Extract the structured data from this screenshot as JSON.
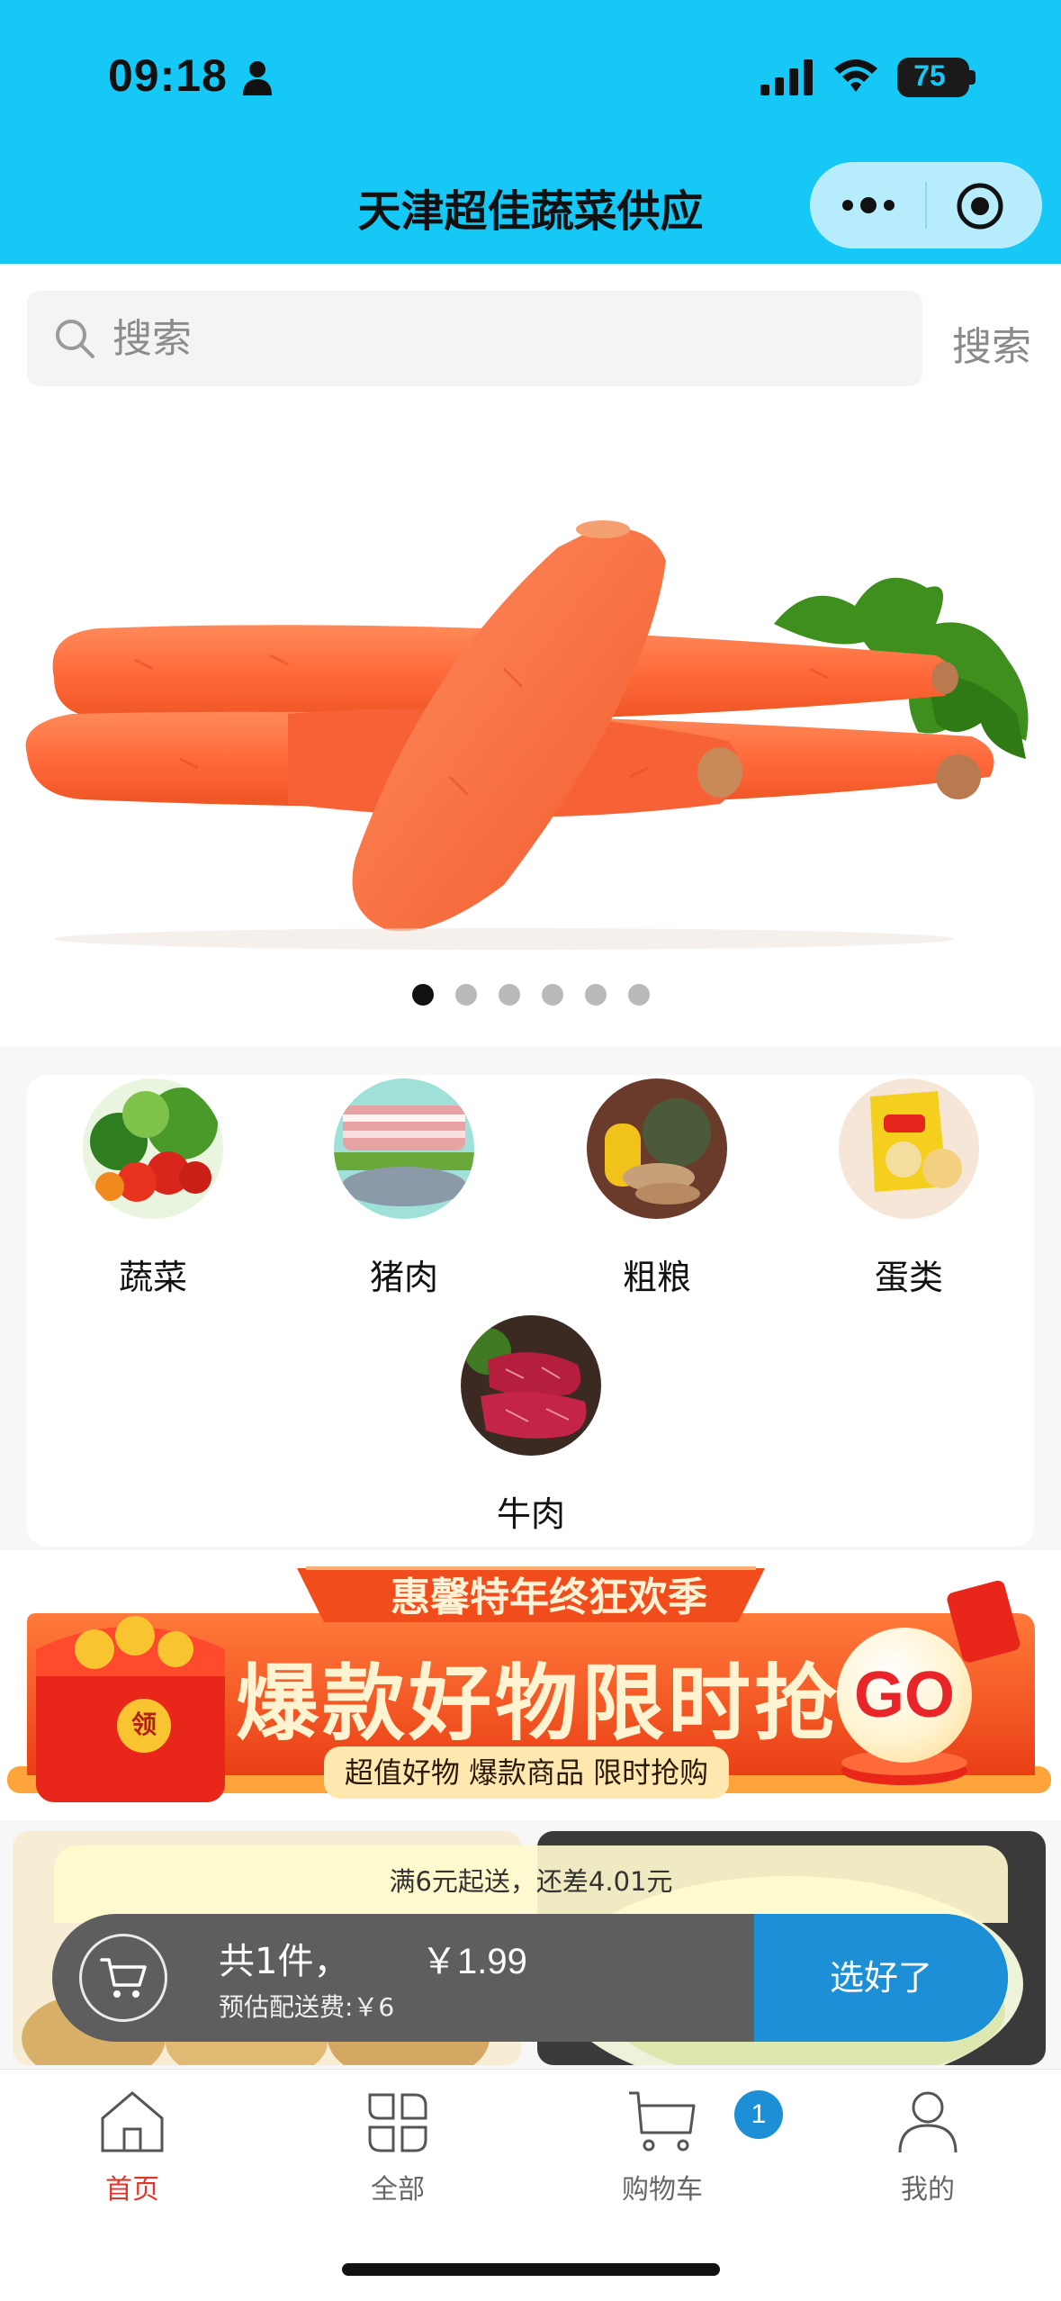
{
  "status_bar": {
    "time": "09:18",
    "battery": "75"
  },
  "nav": {
    "title": "天津超佳蔬菜供应"
  },
  "search": {
    "placeholder": "搜索",
    "button_label": "搜索"
  },
  "banner": {
    "slide_count": 6,
    "active_index": 0
  },
  "categories": [
    {
      "label": "蔬菜"
    },
    {
      "label": "猪肉"
    },
    {
      "label": "粗粮"
    },
    {
      "label": "蛋类"
    },
    {
      "label": "牛肉"
    }
  ],
  "promo": {
    "title": "惠馨特年终狂欢季",
    "headline": "爆款好物限时抢",
    "subline": "超值好物 爆款商品 限时抢购",
    "go_label": "GO",
    "coupon_label": "领"
  },
  "cart": {
    "minimum_tip": "满6元起送，还差4.01元",
    "count_text": "共1件，",
    "price_text": "￥1.99",
    "delivery_fee_text": "预估配送费:￥6",
    "checkout_label": "选好了"
  },
  "tabbar": {
    "items": [
      {
        "label": "首页",
        "icon": "home-icon",
        "active": true
      },
      {
        "label": "全部",
        "icon": "grid-icon",
        "active": false
      },
      {
        "label": "购物车",
        "icon": "cart-icon",
        "active": false
      },
      {
        "label": "我的",
        "icon": "user-icon",
        "active": false
      }
    ],
    "cart_badge": "1"
  },
  "colors": {
    "header_bg": "#16c8f6",
    "accent_blue": "#1d8fd6",
    "active_tab_red": "#e1372b",
    "promo_orange": "#f15a24"
  }
}
